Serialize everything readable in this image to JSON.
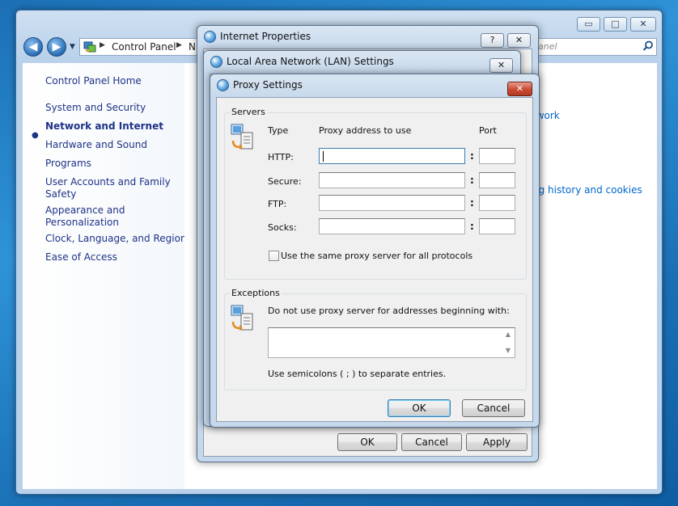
{
  "control_panel": {
    "window_buttons": {
      "minimize": "▭",
      "maximize": "□",
      "close": "✕"
    },
    "nav": {
      "back": "◀",
      "forward": "▶",
      "recent": "▼"
    },
    "address": {
      "separator": "▶",
      "root": "Control Panel",
      "partial": "N"
    },
    "search": {
      "placeholder": "anel"
    },
    "left_nav": {
      "home": "Control Panel Home",
      "items": [
        "System and Security",
        "Network and Internet",
        "Hardware and Sound",
        "Programs",
        "User Accounts and Family Safety",
        "Appearance and Personalization",
        "Clock, Language, and Region",
        "Ease of Access"
      ],
      "current_index": 1,
      "bullet": "●"
    },
    "right_links": {
      "link1": "twork",
      "link2": "ng history and cookies"
    }
  },
  "internet_properties": {
    "title": "Internet Properties",
    "help_button": "?",
    "close_button": "✕",
    "buttons": {
      "ok": "OK",
      "cancel": "Cancel",
      "apply": "Apply"
    }
  },
  "lan_settings": {
    "title": "Local Area Network (LAN) Settings",
    "close_button": "✕"
  },
  "proxy_settings": {
    "title": "Proxy Settings",
    "close_button": "✕",
    "servers": {
      "legend": "Servers",
      "col_type": "Type",
      "col_address": "Proxy address to use",
      "col_port": "Port",
      "rows": [
        {
          "type": "HTTP:",
          "address": "",
          "port": ""
        },
        {
          "type": "Secure:",
          "address": "",
          "port": ""
        },
        {
          "type": "FTP:",
          "address": "",
          "port": ""
        },
        {
          "type": "Socks:",
          "address": "",
          "port": ""
        }
      ],
      "colon": ":",
      "same_proxy_label": "Use the same proxy server for all protocols",
      "same_proxy_checked": false
    },
    "exceptions": {
      "legend": "Exceptions",
      "instruction": "Do not use proxy server for addresses beginning with:",
      "value": "",
      "scroll_up": "▲",
      "scroll_down": "▼",
      "hint": "Use semicolons ( ; ) to separate entries."
    },
    "buttons": {
      "ok": "OK",
      "cancel": "Cancel"
    }
  }
}
